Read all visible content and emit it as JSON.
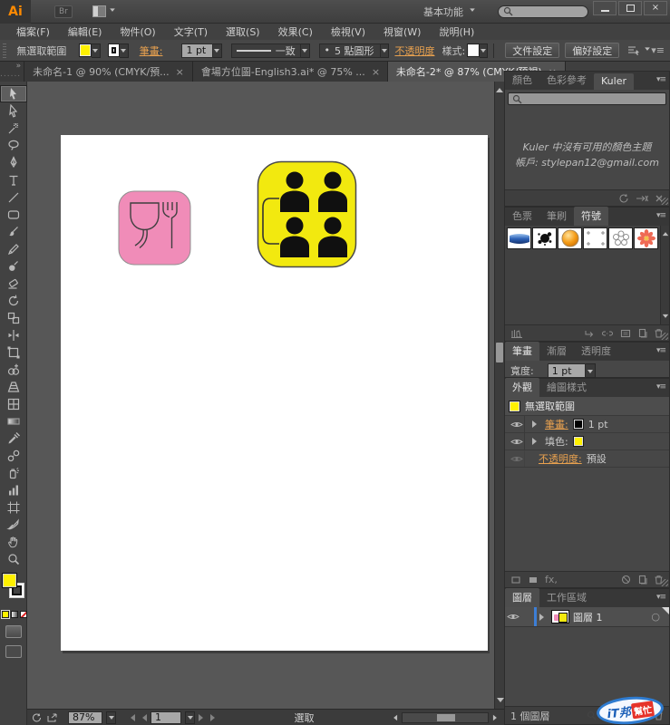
{
  "glyphs": {
    "close": "×",
    "panel_menu": "▾≡",
    "collapse": "»",
    "fx": "fx,",
    "target": "○",
    "bullet": "•",
    "grip_dots": "......"
  },
  "titlebar": {
    "logo": "Ai",
    "bridge": "Br",
    "workspace": "基本功能"
  },
  "menus": [
    "檔案(F)",
    "編輯(E)",
    "物件(O)",
    "文字(T)",
    "選取(S)",
    "效果(C)",
    "檢視(V)",
    "視窗(W)",
    "說明(H)"
  ],
  "control_bar": {
    "selection_status": "無選取範圍",
    "stroke_label": "筆畫:",
    "stroke_width": "1 pt",
    "profile": "一致",
    "brush": "5 點圓形",
    "opacity": "不透明度",
    "style_label": "樣式:",
    "doc_setup": "文件設定",
    "preferences": "偏好設定"
  },
  "doc_tabs": [
    {
      "id": "doc-tab-untitled-1",
      "label": "未命名-1 @ 90% (CMYK/預...",
      "active": false
    },
    {
      "id": "doc-tab-english3",
      "label": "會場方位圖-English3.ai* @ 75% ...",
      "active": false
    },
    {
      "id": "doc-tab-untitled-2",
      "label": "未命名-2* @ 87% (CMYK/預視)",
      "active": true
    }
  ],
  "tools": [
    {
      "id": "selection-tool",
      "active": true
    },
    {
      "id": "direct-selection-tool"
    },
    {
      "id": "magic-wand-tool"
    },
    {
      "id": "lasso-tool"
    },
    {
      "id": "pen-tool"
    },
    {
      "id": "type-tool"
    },
    {
      "id": "line-segment-tool"
    },
    {
      "id": "rectangle-tool"
    },
    {
      "id": "paintbrush-tool"
    },
    {
      "id": "pencil-tool"
    },
    {
      "id": "blob-brush-tool"
    },
    {
      "id": "eraser-tool"
    },
    {
      "id": "rotate-tool"
    },
    {
      "id": "scale-tool"
    },
    {
      "id": "width-tool"
    },
    {
      "id": "free-transform-tool"
    },
    {
      "id": "shape-builder-tool"
    },
    {
      "id": "perspective-grid-tool"
    },
    {
      "id": "mesh-tool"
    },
    {
      "id": "gradient-tool"
    },
    {
      "id": "eyedropper-tool"
    },
    {
      "id": "blend-tool"
    },
    {
      "id": "symbol-sprayer-tool"
    },
    {
      "id": "column-graph-tool"
    },
    {
      "id": "artboard-tool"
    },
    {
      "id": "slice-tool"
    },
    {
      "id": "hand-tool"
    },
    {
      "id": "zoom-tool"
    }
  ],
  "colors": {
    "fill_yellow": "#FFF100",
    "icon_pink": "#F08CB8",
    "icon_yellow": "#F2E90F",
    "accent_orange": "#E8A14F",
    "layer_blue": "#3D7ED6"
  },
  "panels": {
    "color": {
      "tabs": [
        {
          "label": "顏色"
        },
        {
          "label": "色彩參考"
        },
        {
          "label": "Kuler",
          "active": true
        }
      ],
      "message1": "Kuler 中沒有可用的顏色主題",
      "message2": "帳戶: stylepan12@gmail.com"
    },
    "symbols": {
      "tabs": [
        {
          "label": "色票"
        },
        {
          "label": "筆刷"
        },
        {
          "label": "符號",
          "active": true
        }
      ],
      "items": [
        {
          "id": "ribbon-symbol"
        },
        {
          "id": "ink-splat-symbol"
        },
        {
          "id": "orb-symbol"
        },
        {
          "id": "registration-symbol"
        },
        {
          "id": "flower-outline-symbol"
        },
        {
          "id": "daisy-symbol"
        }
      ]
    },
    "stroke": {
      "tabs": [
        {
          "label": "筆畫",
          "active": true
        },
        {
          "label": "漸層"
        },
        {
          "label": "透明度"
        }
      ],
      "width_label": "寬度:",
      "width_value": "1 pt"
    },
    "appearance": {
      "tabs": [
        {
          "label": "外觀",
          "active": true
        },
        {
          "label": "繪圖樣式"
        }
      ],
      "no_selection": "無選取範圍",
      "stroke_label": "筆畫:",
      "stroke_value": "1 pt",
      "fill_label": "填色:",
      "opacity_label": "不透明度:",
      "opacity_value": "預設"
    },
    "layers": {
      "tabs": [
        {
          "label": "圖層",
          "active": true
        },
        {
          "label": "工作區域"
        }
      ],
      "layer_name": "圖層 1",
      "count": "1 個圖層"
    }
  },
  "status_bar": {
    "zoom": "87%",
    "page": "1",
    "mode": "選取"
  },
  "watermark": {
    "t1": "iT邦",
    "t2": "幫忙"
  }
}
